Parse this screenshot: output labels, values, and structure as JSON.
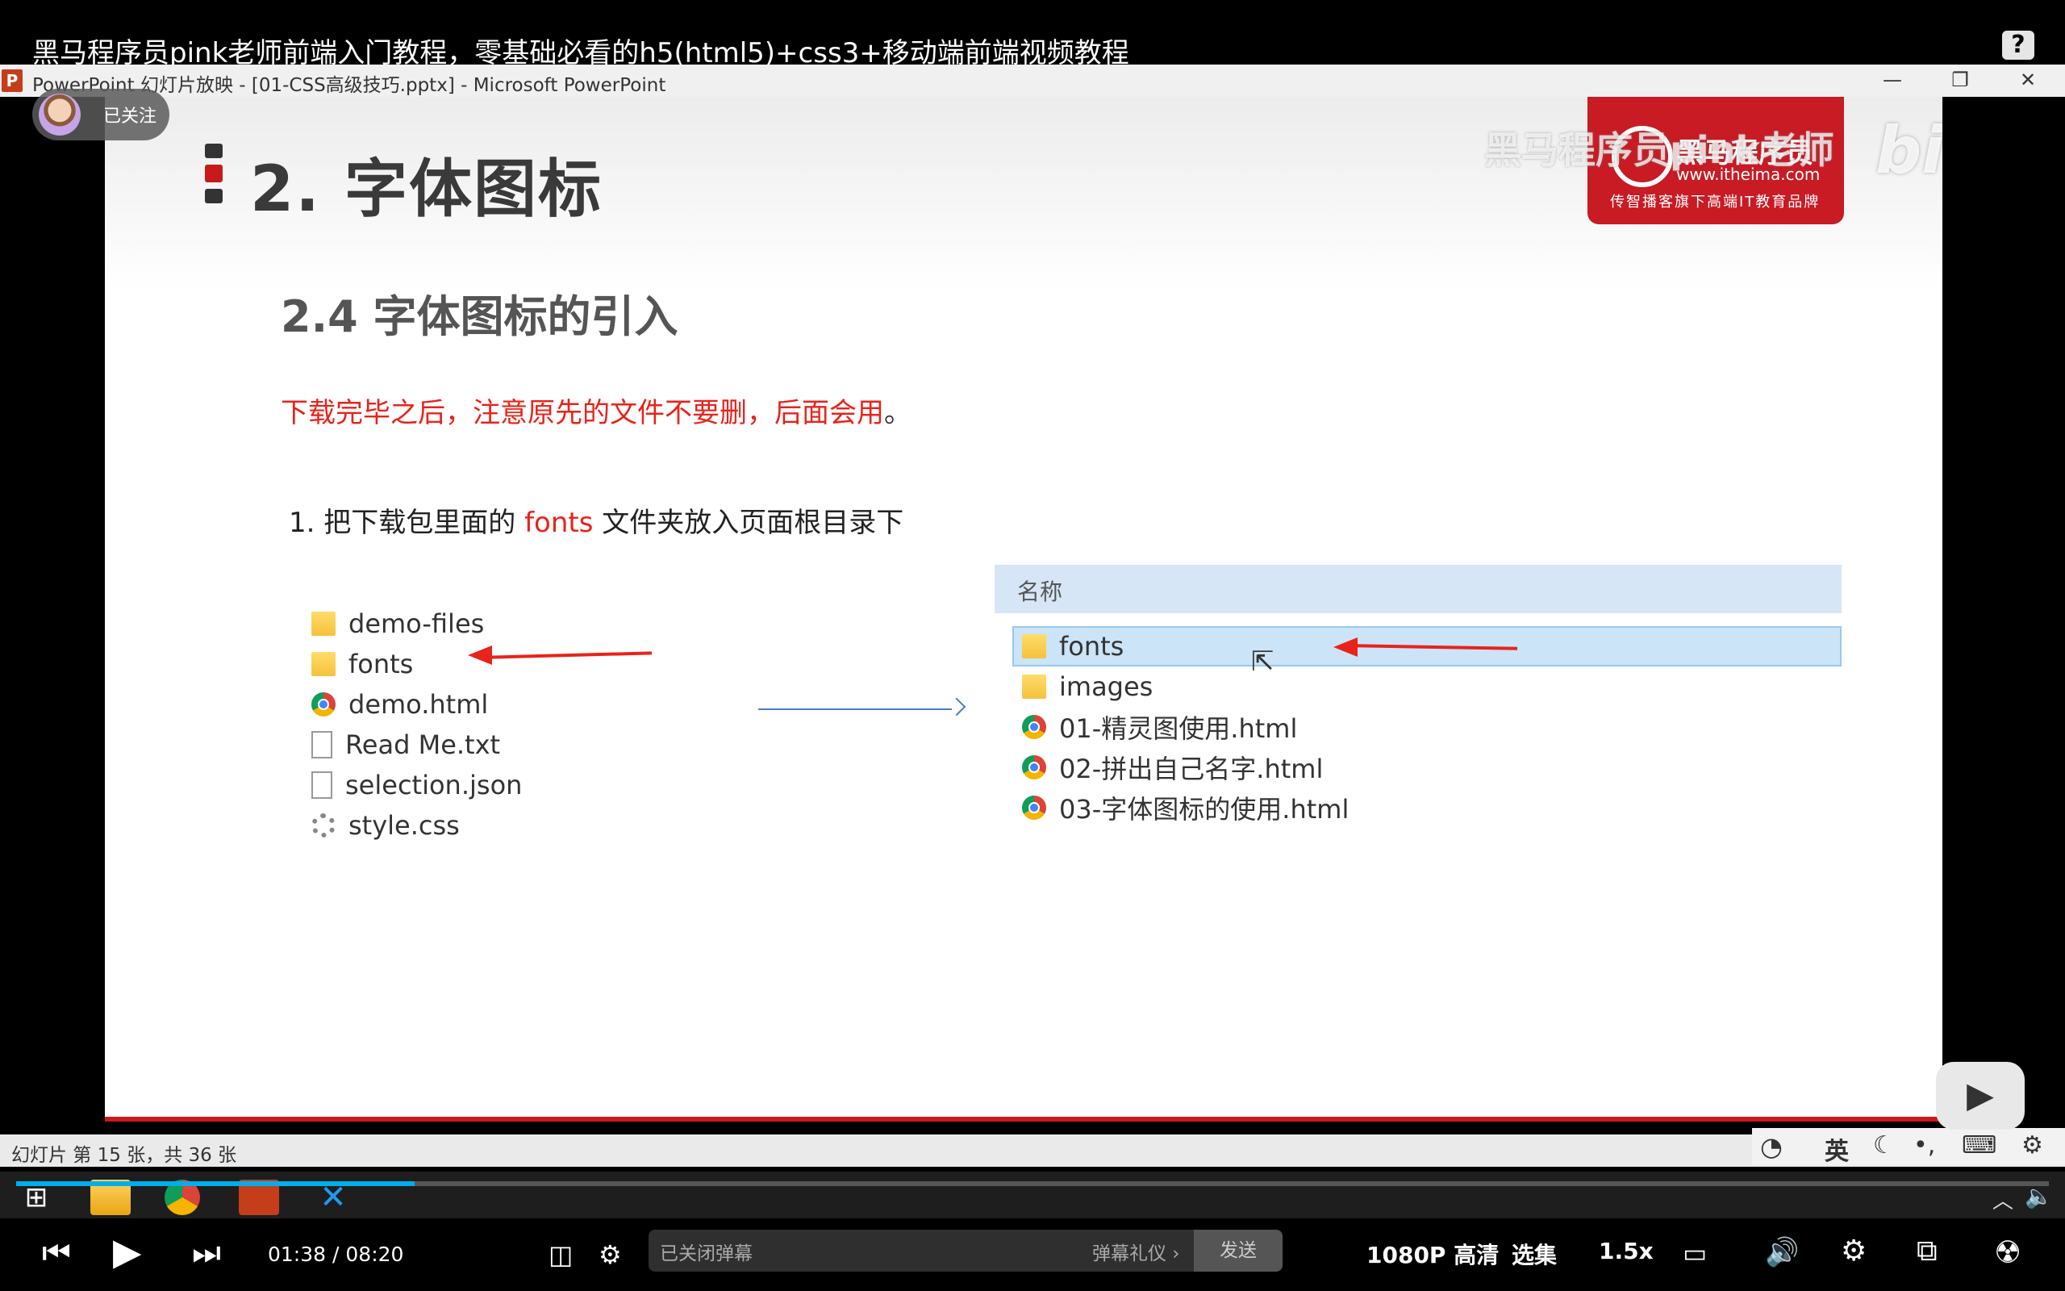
{
  "video": {
    "title": "黑马程序员pink老师前端入门教程，零基础必看的h5(html5)+css3+移动端前端视频教程",
    "help_label": "?",
    "follow_label": "已关注"
  },
  "ppt_window": {
    "app_icon": "P",
    "title": "PowerPoint 幻灯片放映 - [01-CSS高级技巧.pptx] - Microsoft PowerPoint",
    "minimize": "—",
    "restore": "❐",
    "close": "✕",
    "status": "幻灯片 第 15 张，共 36 张"
  },
  "slide": {
    "title": "2. 字体图标",
    "subtitle": "2.4 字体图标的引入",
    "note": "下载完毕之后，注意原先的文件不要删，后面会用",
    "note_period": "。",
    "step_prefix": "1. 把下载包里面的 ",
    "step_highlight": "fonts",
    "step_suffix": " 文件夹放入页面根目录下",
    "logo": {
      "name": "黑马程序员",
      "url": "www.itheima.com",
      "slogan": "传智播客旗下高端IT教育品牌"
    },
    "watermark": "黑马程序员pink老师",
    "bili_watermark": "bilibili",
    "left_files": [
      {
        "name": "demo-files",
        "icon": "folder-icon"
      },
      {
        "name": "fonts",
        "icon": "folder-icon"
      },
      {
        "name": "demo.html",
        "icon": "chrome-icon"
      },
      {
        "name": "Read Me.txt",
        "icon": "text-file-icon"
      },
      {
        "name": "selection.json",
        "icon": "file-icon"
      },
      {
        "name": "style.css",
        "icon": "css-file-icon"
      }
    ],
    "explorer_header": "名称",
    "right_files": [
      {
        "name": "fonts",
        "icon": "folder-icon",
        "selected": true
      },
      {
        "name": "images",
        "icon": "folder-icon"
      },
      {
        "name": "01-精灵图使用.html",
        "icon": "chrome-icon"
      },
      {
        "name": "02-拼出自己名字.html",
        "icon": "chrome-icon"
      },
      {
        "name": "03-字体图标的使用.html",
        "icon": "chrome-icon"
      }
    ]
  },
  "ime": {
    "lang": "英",
    "items": [
      "moon-icon",
      "punctuation-icon",
      "keyboard-icon",
      "gear-icon"
    ]
  },
  "player": {
    "current_time": "01:38",
    "separator": "/",
    "total_time": "08:20",
    "progress": 0.196,
    "danmaku_placeholder": "已关闭弹幕",
    "danmaku_etiquette": "弹幕礼仪 ›",
    "send_label": "发送",
    "quality": "1080P 高清",
    "episodes": "选集",
    "speed": "1.5x"
  },
  "colors": {
    "accent_red": "#e8231b",
    "brand_red": "#c81b24",
    "bili_blue": "#00aeec"
  }
}
